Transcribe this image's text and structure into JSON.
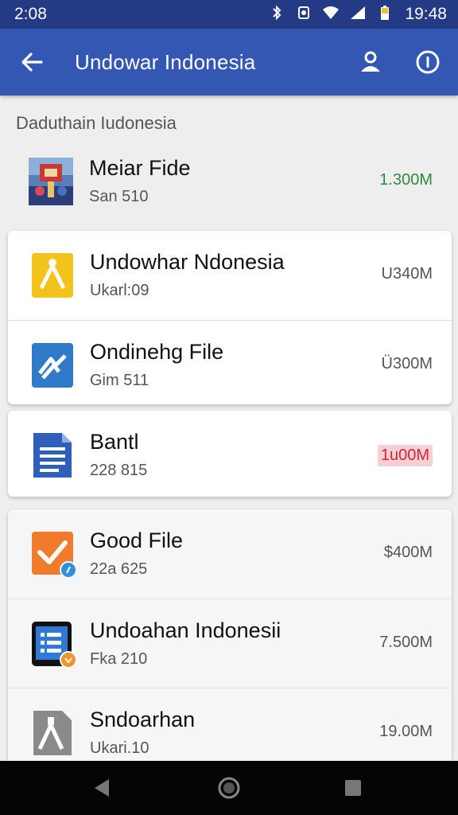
{
  "status_bar": {
    "time_left": "2:08",
    "time_right": "19:48"
  },
  "app_bar": {
    "title": "Undowar Indonesia"
  },
  "section": {
    "label": "Daduthain Iudonesia"
  },
  "items": [
    {
      "name": "Meiar Fide",
      "meta": "San 510",
      "size": "1.300M",
      "icon": "photo-thumbnail-icon"
    },
    {
      "name": "Undowhar Ndonesia",
      "meta": "Ukarl:09",
      "size": "U340M",
      "icon": "yellow-file-icon"
    },
    {
      "name": "Ondinehg File",
      "meta": "Gim 511",
      "size": "Ü300M",
      "icon": "blue-link-file-icon"
    },
    {
      "name": "Bantl",
      "meta": "228 815",
      "size": "1u00M",
      "icon": "document-icon"
    },
    {
      "name": "Good File",
      "meta": "22a 625",
      "size": "$400M",
      "icon": "orange-check-file-icon"
    },
    {
      "name": "Undoahan Indonesii",
      "meta": "Fka 210",
      "size": "7.500M",
      "icon": "tablet-file-icon"
    },
    {
      "name": "Sndoarhan",
      "meta": "Ukari.10",
      "size": "19.00M",
      "icon": "gray-file-icon"
    }
  ],
  "colors": {
    "status_bar": "#243a84",
    "app_bar": "#3457b3",
    "free_size": "#2e8b40",
    "warn_size": "#d0263a"
  }
}
